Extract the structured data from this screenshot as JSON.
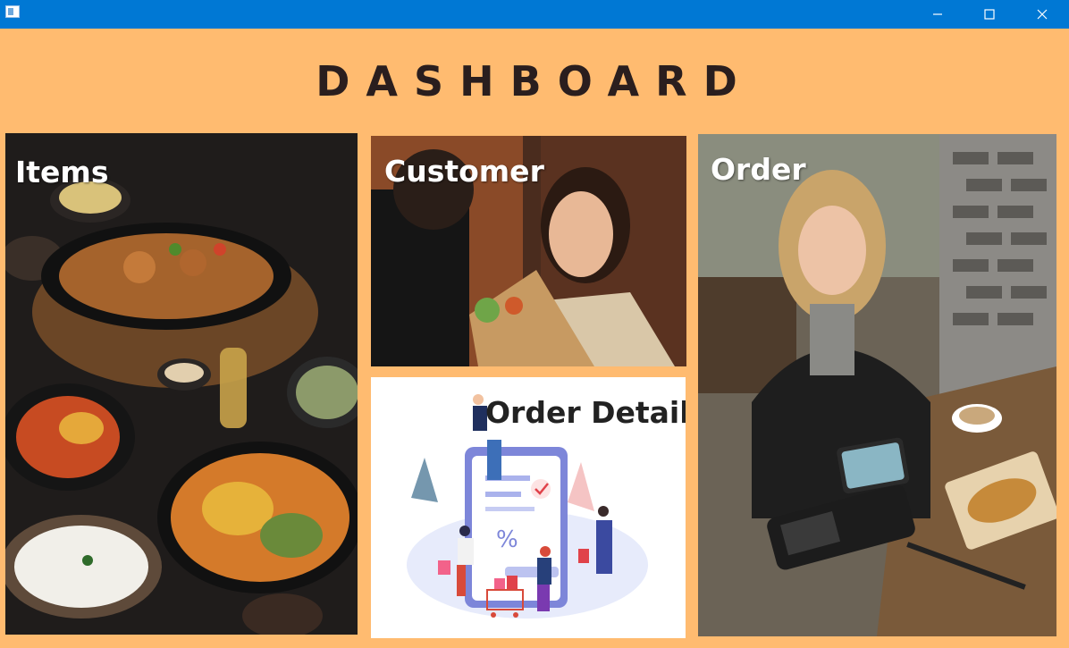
{
  "window": {
    "minimize_icon": "minimize-icon",
    "maximize_icon": "maximize-icon",
    "close_icon": "close-icon"
  },
  "page": {
    "title": "DASHBOARD"
  },
  "tiles": {
    "items": {
      "label": "Items"
    },
    "customer": {
      "label": "Customer"
    },
    "order": {
      "label": "Order"
    },
    "order_detail": {
      "label": "Order Detail"
    }
  },
  "colors": {
    "background": "#ffbb70",
    "titlebar": "#0078d4"
  }
}
